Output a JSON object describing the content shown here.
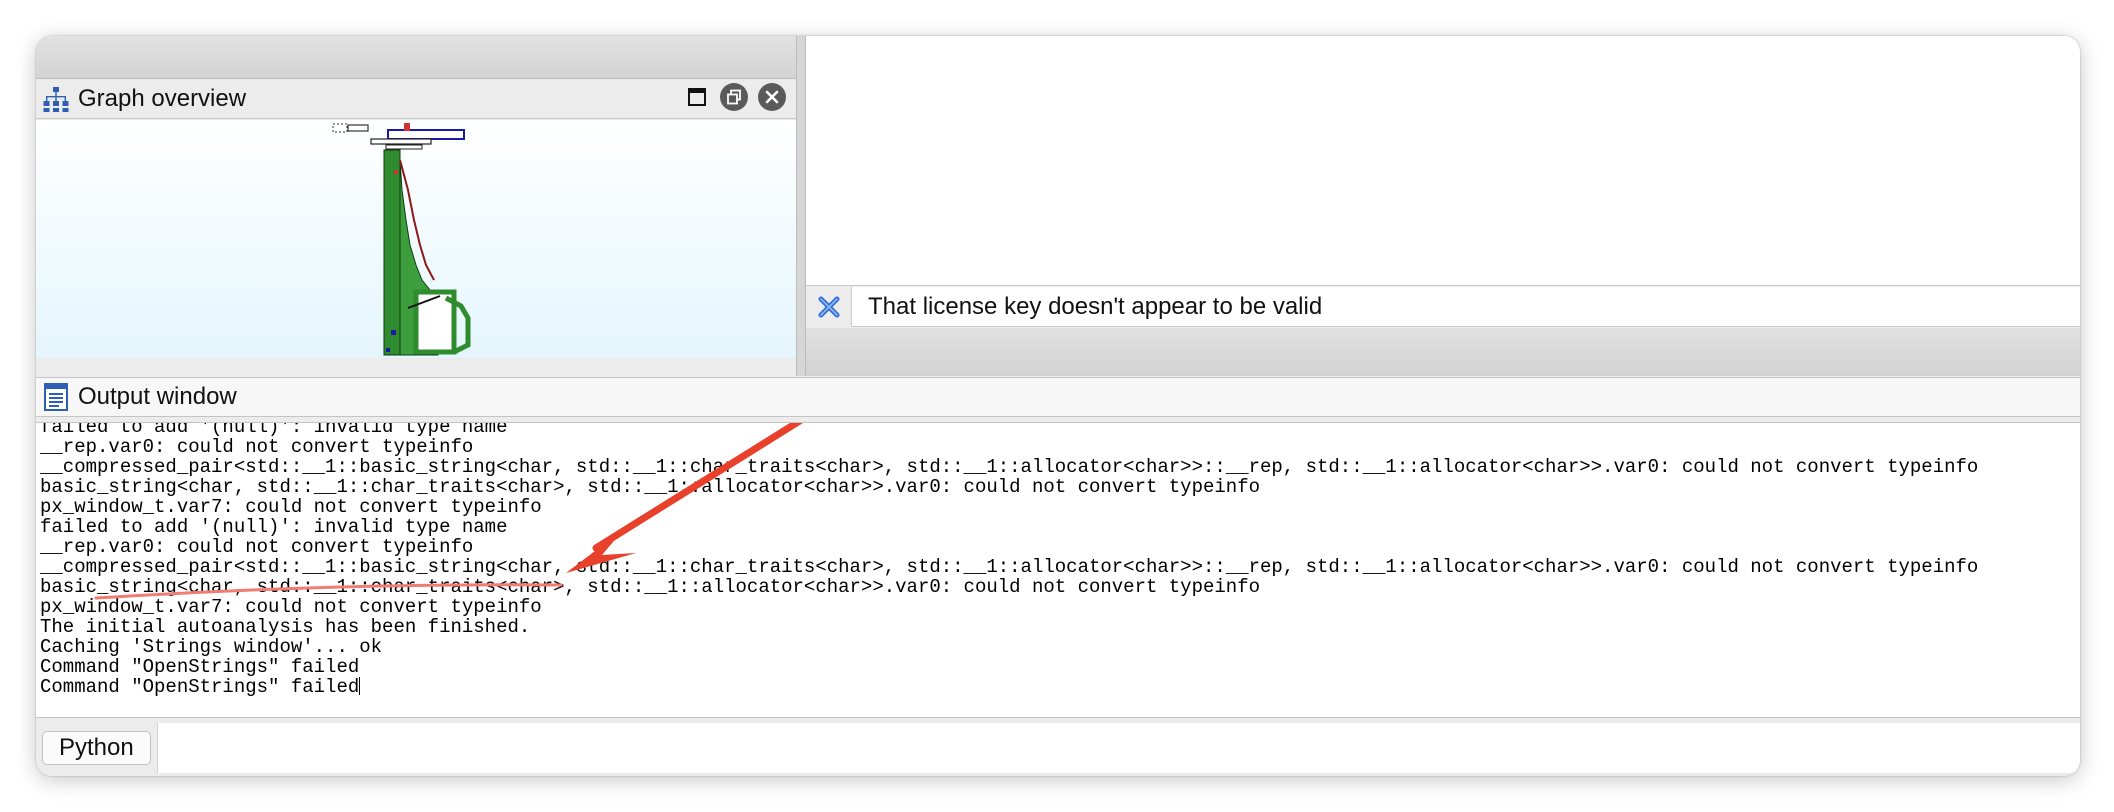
{
  "graph_overview": {
    "title": "Graph overview",
    "icon": "graph-tree-icon",
    "controls": [
      "maximize-icon",
      "restore-icon",
      "close-icon"
    ]
  },
  "notification": {
    "icon": "close-x-icon",
    "text": "That license key doesn't appear to be valid"
  },
  "output_window": {
    "title": "Output window",
    "icon": "document-lines-icon",
    "lines": [
      "failed to add '(null)': invalid type name",
      "__rep.var0: could not convert typeinfo",
      "__compressed_pair<std::__1::basic_string<char, std::__1::char_traits<char>, std::__1::allocator<char>>::__rep, std::__1::allocator<char>>.var0: could not convert typeinfo",
      "basic_string<char, std::__1::char_traits<char>, std::__1::allocator<char>>.var0: could not convert typeinfo",
      "px_window_t.var7: could not convert typeinfo",
      "failed to add '(null)': invalid type name",
      "__rep.var0: could not convert typeinfo",
      "__compressed_pair<std::__1::basic_string<char, std::__1::char_traits<char>, std::__1::allocator<char>>::__rep, std::__1::allocator<char>>.var0: could not convert typeinfo",
      "basic_string<char, std::__1::char_traits<char>, std::__1::allocator<char>>.var0: could not convert typeinfo",
      "px_window_t.var7: could not convert typeinfo",
      "The initial autoanalysis has been finished.",
      "Caching 'Strings window'... ok",
      "Command \"OpenStrings\" failed",
      "Command \"OpenStrings\" failed"
    ]
  },
  "cli": {
    "language_label": "Python",
    "input_value": ""
  },
  "colors": {
    "graph_green": "#2e8b2e",
    "graph_blue": "#1a1aa8",
    "annotation_red": "#e8402a",
    "notice_x_blue": "#2f6fd6"
  }
}
